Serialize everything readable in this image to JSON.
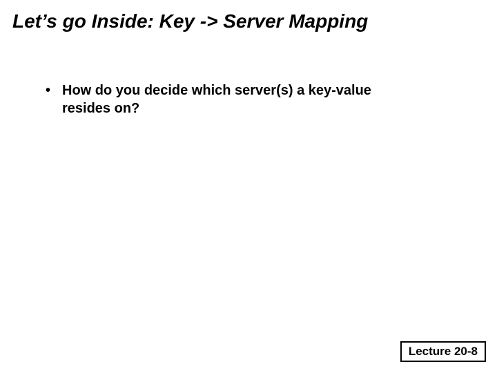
{
  "title": "Let’s go Inside: Key -> Server Mapping",
  "bullets": [
    {
      "text": "How do you decide which server(s) a key-value resides on?"
    }
  ],
  "footer": "Lecture 20-8"
}
